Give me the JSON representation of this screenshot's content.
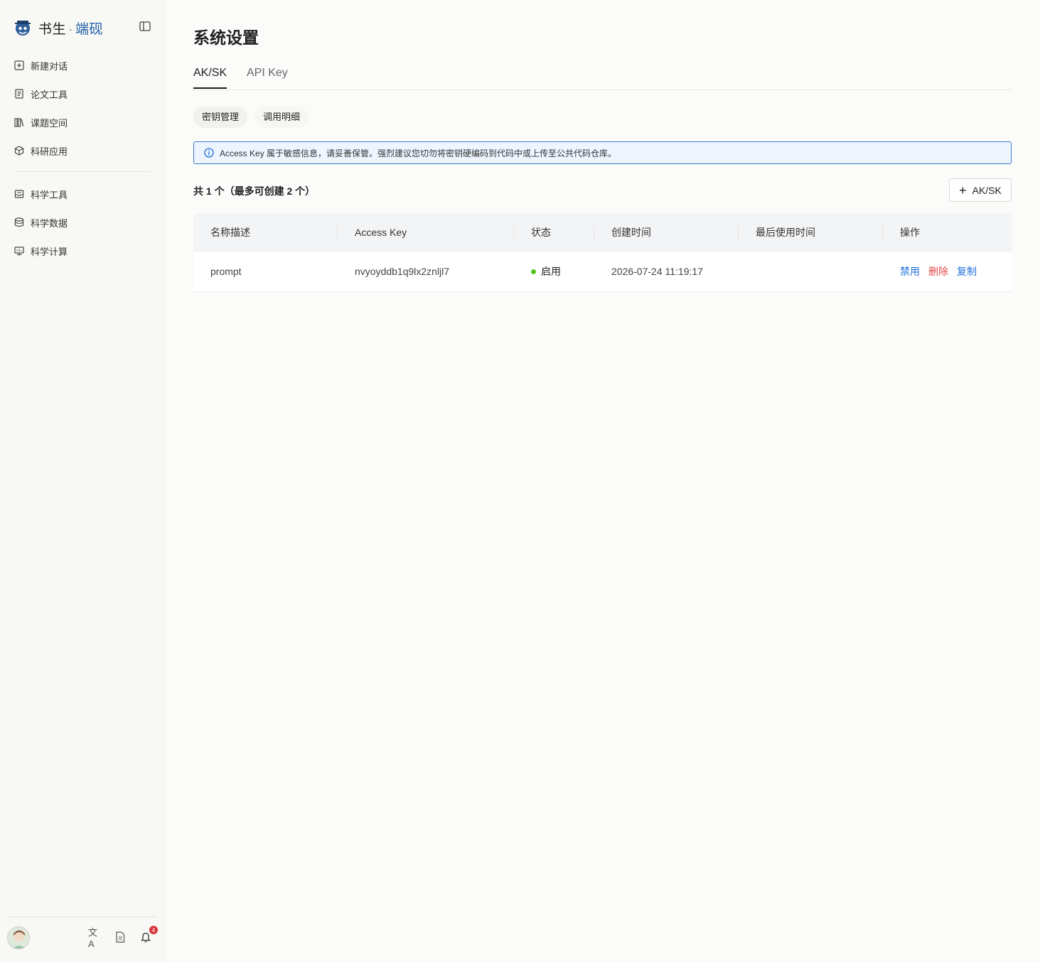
{
  "sidebar": {
    "logo_main": "书生",
    "logo_dot": "·",
    "logo_accent": "端砚",
    "nav_top": [
      {
        "label": "新建对话",
        "icon": "plus-square-icon"
      },
      {
        "label": "论文工具",
        "icon": "document-icon"
      },
      {
        "label": "课题空间",
        "icon": "library-icon"
      },
      {
        "label": "科研应用",
        "icon": "cube-icon"
      }
    ],
    "nav_bottom": [
      {
        "label": "科学工具",
        "icon": "toolbox-icon"
      },
      {
        "label": "科学数据",
        "icon": "database-icon"
      },
      {
        "label": "科学计算",
        "icon": "monitor-icon"
      }
    ],
    "translate_icon_text": "文A",
    "notification_count": "4"
  },
  "main": {
    "title": "系统设置",
    "tabs": [
      {
        "label": "AK/SK",
        "active": true
      },
      {
        "label": "API Key",
        "active": false
      }
    ],
    "subtabs": [
      {
        "label": "密钥管理",
        "active": true
      },
      {
        "label": "调用明细",
        "active": false
      }
    ],
    "alert_text": "Access Key 属于敏感信息，请妥善保管。强烈建议您切勿将密钥硬编码到代码中或上传至公共代码仓库。",
    "count_text": "共 1 个（最多可创建 2 个）",
    "add_button_label": "AK/SK",
    "table": {
      "columns": [
        "名称描述",
        "Access Key",
        "状态",
        "创建时间",
        "最后使用时间",
        "操作"
      ],
      "rows": [
        {
          "name": "prompt",
          "access_key": "nvyoyddb1q9lx2znljl7",
          "status": "启用",
          "created": "2026-07-24 11:19:17",
          "last_used": "",
          "actions": [
            "禁用",
            "删除",
            "复制"
          ]
        }
      ]
    }
  },
  "colors": {
    "accent_blue": "#1d6fd8",
    "danger_red": "#e5484d",
    "status_green": "#52c41a",
    "alert_border": "#3d7bd0"
  }
}
